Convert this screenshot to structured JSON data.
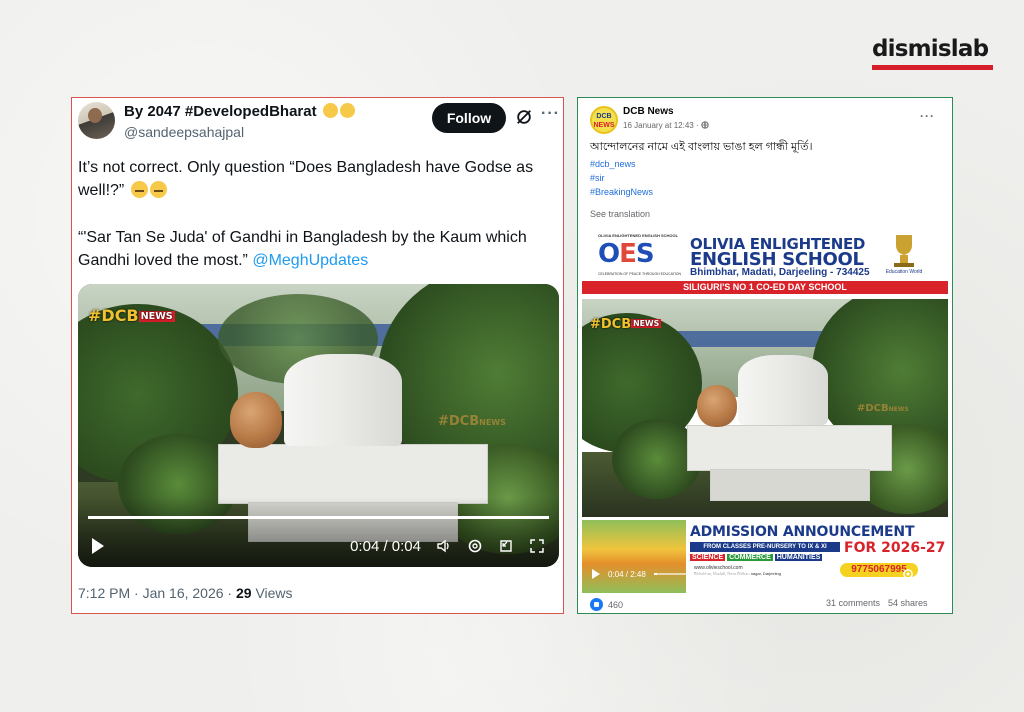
{
  "brand": {
    "name": "dismislab",
    "accent": "#d61f2a"
  },
  "tweet": {
    "display_name": "By 2047 #DevelopedBharat",
    "handle": "@sandeepsahajpal",
    "follow_label": "Follow",
    "text_line1": "It’s not correct. Only question “Does Bangladesh have Godse as well!?”",
    "text_quote": "“'Sar Tan Se Juda' of Gandhi in Bangladesh by the Kaum which Gandhi loved the most.”",
    "mention": "@MeghUpdates",
    "video": {
      "watermark": "#DCB",
      "watermark_news": "NEWS",
      "time": "0:04 / 0:04",
      "progress": 1.0
    },
    "time": "7:12 PM · Jan 16, 2026 · ",
    "views_count": "29",
    "views_label": " Views"
  },
  "facebook": {
    "page_name": "DCB News",
    "date": "16 January at 12:43 ·",
    "avatar_text": "DCB",
    "avatar_sub": "NEWS",
    "post_text": "আন্দোলনের নামে এই বাংলায় ভাঙা হল গান্ধী মূর্তি।",
    "hashtags": [
      "#dcb_news",
      "#sir",
      "#BreakingNews"
    ],
    "see_translation": "See translation",
    "ad_top": {
      "school_small": "OLIVIA ENLIGHTENED ENGLISH SCHOOL",
      "logo": "OES",
      "logo_sub": "CELEBRATION OF PEACE THROUGH EDUCATION",
      "name1": "OLIVIA ENLIGHTENED",
      "name2": "ENGLISH SCHOOL",
      "address": "Bhimbhar, Madati, Darjeeling - 734425",
      "banner": "SILIGURI'S NO 1 CO-ED DAY SCHOOL",
      "award": "Education World"
    },
    "ad_bottom": {
      "title": "ADMISSION ANNOUNCEMENT",
      "from": "FROM CLASSES PRE-NURSERY TO IX & XI",
      "subjects": [
        "SCIENCE",
        "COMMERCE",
        "HUMANITIES"
      ],
      "year": "FOR 2026-27",
      "website": "www.olivieschool.com",
      "addr": "Bhimbhar, Madati, Near Bidhan nagar, Darjeeling",
      "phone": "9775067995"
    },
    "video": {
      "watermark": "#DCB",
      "watermark_news": "NEWS",
      "time": "0:04 / 2:48",
      "progress": 0.03
    },
    "likes": "460",
    "comments": "31 comments",
    "shares": "54 shares"
  }
}
